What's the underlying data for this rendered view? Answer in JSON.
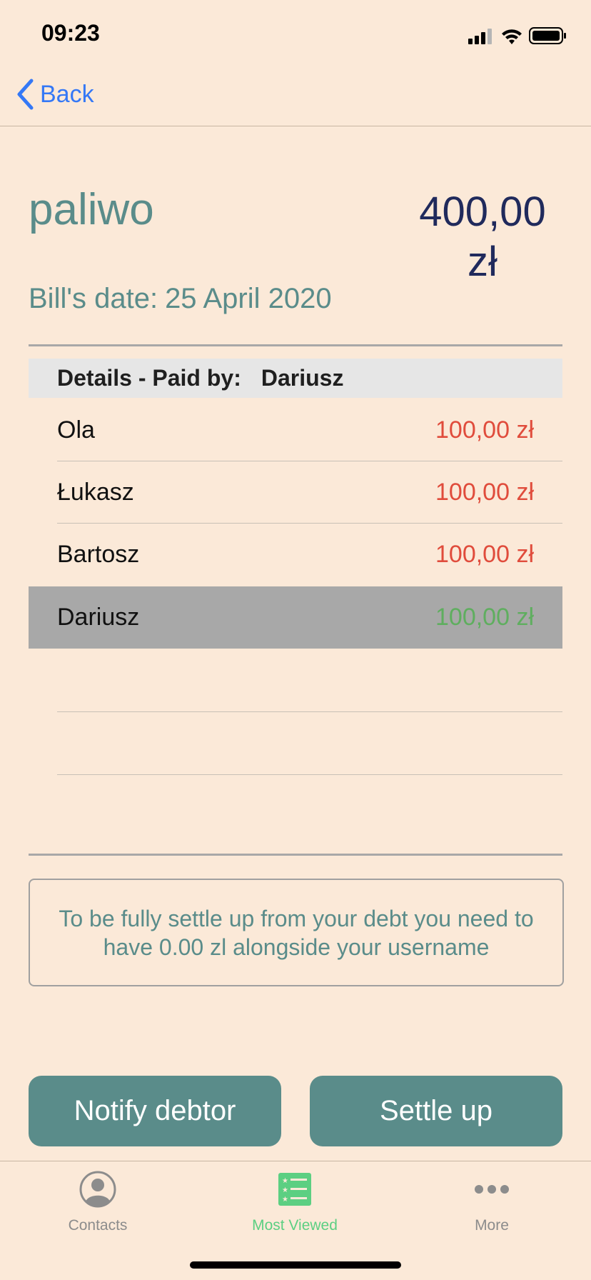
{
  "status_bar": {
    "time": "09:23"
  },
  "nav": {
    "back_label": "Back"
  },
  "bill": {
    "name": "paliwo",
    "amount_line1": "400,00",
    "amount_line2": "zł",
    "date_label": "Bill's date:",
    "date_value": "25 April 2020"
  },
  "details": {
    "header_label": "Details - Paid by:",
    "paid_by": "Dariusz",
    "rows": [
      {
        "name": "Ola",
        "amount": "100,00 zł",
        "status_color": "#e04c3c"
      },
      {
        "name": "Łukasz",
        "amount": "100,00 zł",
        "status_color": "#e04c3c"
      },
      {
        "name": "Bartosz",
        "amount": "100,00 zł",
        "status_color": "#e04c3c"
      },
      {
        "name": "Dariusz",
        "amount": "100,00 zł",
        "status_color": "#5fae5f",
        "highlighted": true
      }
    ]
  },
  "info": {
    "text": "To be fully settle up from your debt you need to have 0.00 zl alongside your username"
  },
  "actions": {
    "notify_label": "Notify debtor",
    "settle_label": "Settle up"
  },
  "tab_bar": {
    "items": [
      {
        "label": "Contacts",
        "icon": "person-circle-icon"
      },
      {
        "label": "Most Viewed",
        "icon": "starred-list-icon",
        "active": true
      },
      {
        "label": "More",
        "icon": "more-dots-icon"
      }
    ]
  },
  "colors": {
    "background": "#fbe9d8",
    "accent": "#5a8c8a",
    "link": "#3478f6",
    "debt": "#e04c3c",
    "paid": "#5fae5f",
    "active_tab": "#5ccf82"
  }
}
